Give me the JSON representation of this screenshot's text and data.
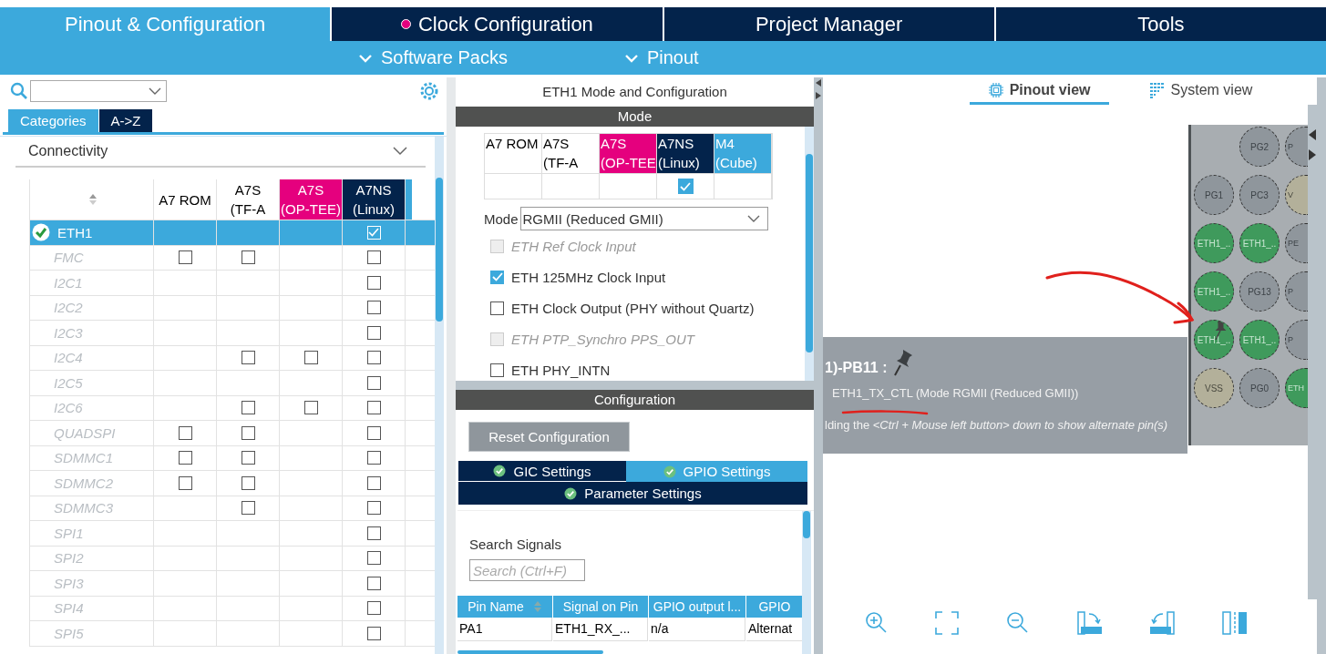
{
  "top_tabs": [
    {
      "label": "Pinout & Configuration",
      "selected": true,
      "dot": false
    },
    {
      "label": "Clock Configuration",
      "selected": false,
      "dot": true
    },
    {
      "label": "Project Manager",
      "selected": false,
      "dot": false
    },
    {
      "label": "Tools",
      "selected": false,
      "dot": false
    }
  ],
  "sub_menu": [
    {
      "label": "Software Packs"
    },
    {
      "label": "Pinout"
    }
  ],
  "category_tabs": [
    {
      "label": "Categories",
      "selected": true
    },
    {
      "label": "A->Z",
      "selected": false
    }
  ],
  "category": {
    "label": "Connectivity",
    "expanded": true
  },
  "ip_table": {
    "columns": [
      {
        "label": "A7 ROM",
        "color": "#ffffff"
      },
      {
        "label": "A7S\n(TF-A",
        "color": "#ffffff"
      },
      {
        "label": "A7S\n(OP-TEE)",
        "color": "#e5007e"
      },
      {
        "label": "A7NS\n(Linux)",
        "color": "#03234b"
      }
    ],
    "rows": [
      {
        "name": "ETH1",
        "selected": true,
        "disabled": false,
        "configured": true,
        "cells": [
          {
            "kind": "empty"
          },
          {
            "kind": "empty"
          },
          {
            "kind": "empty"
          },
          {
            "kind": "checkbox",
            "checked": true
          }
        ]
      },
      {
        "name": "FMC",
        "selected": false,
        "disabled": true,
        "configured": false,
        "cells": [
          {
            "kind": "checkbox",
            "checked": false
          },
          {
            "kind": "checkbox",
            "checked": false
          },
          {
            "kind": "empty"
          },
          {
            "kind": "checkbox",
            "checked": false
          }
        ]
      },
      {
        "name": "I2C1",
        "selected": false,
        "disabled": true,
        "configured": false,
        "cells": [
          {
            "kind": "empty"
          },
          {
            "kind": "empty"
          },
          {
            "kind": "empty"
          },
          {
            "kind": "checkbox",
            "checked": false
          }
        ]
      },
      {
        "name": "I2C2",
        "selected": false,
        "disabled": true,
        "configured": false,
        "cells": [
          {
            "kind": "empty"
          },
          {
            "kind": "empty"
          },
          {
            "kind": "empty"
          },
          {
            "kind": "checkbox",
            "checked": false
          }
        ]
      },
      {
        "name": "I2C3",
        "selected": false,
        "disabled": true,
        "configured": false,
        "cells": [
          {
            "kind": "empty"
          },
          {
            "kind": "empty"
          },
          {
            "kind": "empty"
          },
          {
            "kind": "checkbox",
            "checked": false
          }
        ]
      },
      {
        "name": "I2C4",
        "selected": false,
        "disabled": true,
        "configured": false,
        "cells": [
          {
            "kind": "empty"
          },
          {
            "kind": "checkbox",
            "checked": false
          },
          {
            "kind": "checkbox",
            "checked": false
          },
          {
            "kind": "checkbox",
            "checked": false
          }
        ]
      },
      {
        "name": "I2C5",
        "selected": false,
        "disabled": true,
        "configured": false,
        "cells": [
          {
            "kind": "empty"
          },
          {
            "kind": "empty"
          },
          {
            "kind": "empty"
          },
          {
            "kind": "checkbox",
            "checked": false
          }
        ]
      },
      {
        "name": "I2C6",
        "selected": false,
        "disabled": true,
        "configured": false,
        "cells": [
          {
            "kind": "empty"
          },
          {
            "kind": "checkbox",
            "checked": false
          },
          {
            "kind": "checkbox",
            "checked": false
          },
          {
            "kind": "checkbox",
            "checked": false
          }
        ]
      },
      {
        "name": "QUADSPI",
        "selected": false,
        "disabled": true,
        "configured": false,
        "cells": [
          {
            "kind": "checkbox",
            "checked": false
          },
          {
            "kind": "checkbox",
            "checked": false
          },
          {
            "kind": "empty"
          },
          {
            "kind": "checkbox",
            "checked": false
          }
        ]
      },
      {
        "name": "SDMMC1",
        "selected": false,
        "disabled": true,
        "configured": false,
        "cells": [
          {
            "kind": "checkbox",
            "checked": false
          },
          {
            "kind": "checkbox",
            "checked": false
          },
          {
            "kind": "empty"
          },
          {
            "kind": "checkbox",
            "checked": false
          }
        ]
      },
      {
        "name": "SDMMC2",
        "selected": false,
        "disabled": true,
        "configured": false,
        "cells": [
          {
            "kind": "checkbox",
            "checked": false
          },
          {
            "kind": "checkbox",
            "checked": false
          },
          {
            "kind": "empty"
          },
          {
            "kind": "checkbox",
            "checked": false
          }
        ]
      },
      {
        "name": "SDMMC3",
        "selected": false,
        "disabled": true,
        "configured": false,
        "cells": [
          {
            "kind": "empty"
          },
          {
            "kind": "checkbox",
            "checked": false
          },
          {
            "kind": "empty"
          },
          {
            "kind": "checkbox",
            "checked": false
          }
        ]
      },
      {
        "name": "SPI1",
        "selected": false,
        "disabled": true,
        "configured": false,
        "cells": [
          {
            "kind": "empty"
          },
          {
            "kind": "empty"
          },
          {
            "kind": "empty"
          },
          {
            "kind": "checkbox",
            "checked": false
          }
        ]
      },
      {
        "name": "SPI2",
        "selected": false,
        "disabled": true,
        "configured": false,
        "cells": [
          {
            "kind": "empty"
          },
          {
            "kind": "empty"
          },
          {
            "kind": "empty"
          },
          {
            "kind": "checkbox",
            "checked": false
          }
        ]
      },
      {
        "name": "SPI3",
        "selected": false,
        "disabled": true,
        "configured": false,
        "cells": [
          {
            "kind": "empty"
          },
          {
            "kind": "empty"
          },
          {
            "kind": "empty"
          },
          {
            "kind": "checkbox",
            "checked": false
          }
        ]
      },
      {
        "name": "SPI4",
        "selected": false,
        "disabled": true,
        "configured": false,
        "cells": [
          {
            "kind": "empty"
          },
          {
            "kind": "empty"
          },
          {
            "kind": "empty"
          },
          {
            "kind": "checkbox",
            "checked": false
          }
        ]
      },
      {
        "name": "SPI5",
        "selected": false,
        "disabled": true,
        "configured": false,
        "cells": [
          {
            "kind": "empty"
          },
          {
            "kind": "empty"
          },
          {
            "kind": "empty"
          },
          {
            "kind": "checkbox",
            "checked": false
          }
        ]
      }
    ]
  },
  "mode_panel": {
    "title": "ETH1 Mode and Configuration",
    "header": "Mode",
    "columns": [
      {
        "label": "A7 ROM",
        "color": "#ffffff"
      },
      {
        "label": "A7S\n(TF-A",
        "color": "#ffffff"
      },
      {
        "label": "A7S\n(OP-TEE",
        "color": "#e5007e"
      },
      {
        "label": "A7NS\n(Linux)",
        "color": "#03234b"
      },
      {
        "label": "M4\n(Cube)",
        "color": "#3ca9dc"
      }
    ],
    "cells": [
      {
        "kind": "empty"
      },
      {
        "kind": "empty"
      },
      {
        "kind": "empty"
      },
      {
        "kind": "checkbox",
        "checked": true
      },
      {
        "kind": "empty"
      }
    ],
    "mode_label": "Mode",
    "mode_value": "RGMII (Reduced GMII)",
    "options": [
      {
        "label": "ETH Ref Clock Input",
        "checked": false,
        "disabled": true
      },
      {
        "label": "ETH 125MHz Clock Input",
        "checked": true,
        "disabled": false
      },
      {
        "label": "ETH Clock Output (PHY without Quartz)",
        "checked": false,
        "disabled": false
      },
      {
        "label": "ETH PTP_Synchro PPS_OUT",
        "checked": false,
        "disabled": true
      },
      {
        "label": "ETH PHY_INTN",
        "checked": false,
        "disabled": false
      }
    ]
  },
  "configuration": {
    "header": "Configuration",
    "reset_button": "Reset Configuration",
    "tabs": [
      {
        "label": "GIC Settings",
        "selected": false
      },
      {
        "label": "GPIO Settings",
        "selected": true
      },
      {
        "label": "Parameter Settings",
        "selected": false
      }
    ],
    "search_label": "Search Signals",
    "search_placeholder": "Search (Ctrl+F)",
    "columns": [
      "Pin Name",
      "Signal on Pin",
      "GPIO output l...",
      "GPIO"
    ],
    "rows": [
      [
        "PA1",
        "ETH1_RX_...",
        "n/a",
        "Alternat"
      ]
    ]
  },
  "pinout": {
    "view_tabs": [
      {
        "label": "Pinout view",
        "selected": true
      },
      {
        "label": "System view",
        "selected": false
      }
    ],
    "pins": [
      [
        {
          "kind": "empty"
        },
        {
          "kind": "io",
          "label": "PG2",
          "pinned": false
        },
        {
          "kind": "io",
          "label": "P",
          "pinned": false
        }
      ],
      [
        {
          "kind": "io",
          "label": "PG1",
          "pinned": false
        },
        {
          "kind": "io",
          "label": "PC3",
          "pinned": false
        },
        {
          "kind": "power",
          "label": "V",
          "pinned": false
        }
      ],
      [
        {
          "kind": "signal",
          "label": "ETH1_..",
          "pinned": false
        },
        {
          "kind": "signal",
          "label": "ETH1_..",
          "pinned": false
        },
        {
          "kind": "io",
          "label": "PE",
          "pinned": false
        }
      ],
      [
        {
          "kind": "signal",
          "label": "ETH1_..",
          "pinned": false
        },
        {
          "kind": "io",
          "label": "PG13",
          "pinned": false
        },
        {
          "kind": "io",
          "label": "P",
          "pinned": false
        }
      ],
      [
        {
          "kind": "signal",
          "label": "ETH1_..",
          "pinned": true
        },
        {
          "kind": "signal",
          "label": "ETH1_..",
          "pinned": false
        },
        {
          "kind": "io",
          "label": "P",
          "pinned": false
        }
      ],
      [
        {
          "kind": "power",
          "label": "VSS",
          "pinned": false
        },
        {
          "kind": "io",
          "label": "PG0",
          "pinned": false
        },
        {
          "kind": "signal",
          "label": "ETH",
          "pinned": false
        }
      ]
    ],
    "tooltip": {
      "title": "1)-PB11 :",
      "signal": "ETH1_TX_CTL (Mode RGMII (Reduced GMII))",
      "hint": "lding the *<Ctrl + Mouse left button> down to show alternate pin(s)*"
    }
  }
}
